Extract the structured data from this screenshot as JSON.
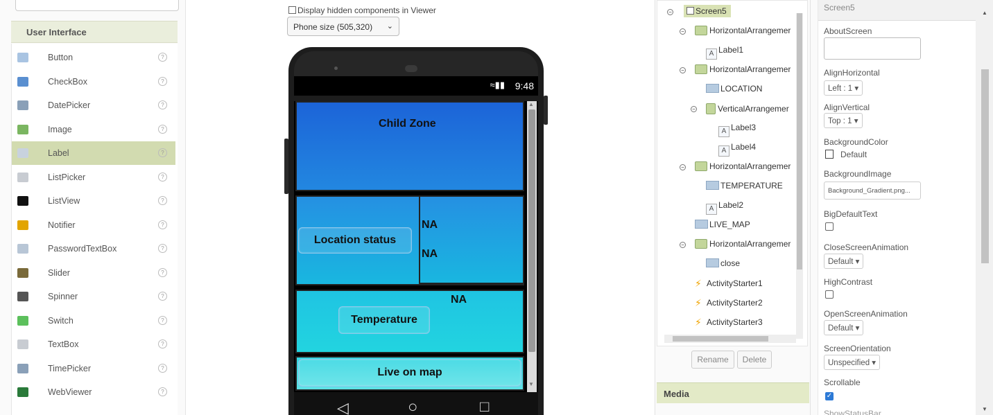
{
  "palette": {
    "section_title": "User Interface",
    "items": [
      {
        "label": "Button",
        "icon": "button-icon",
        "color": "#a9c4e2"
      },
      {
        "label": "CheckBox",
        "icon": "checkbox-icon",
        "color": "#5a8fd0"
      },
      {
        "label": "DatePicker",
        "icon": "datepicker-icon",
        "color": "#8aa0b8"
      },
      {
        "label": "Image",
        "icon": "image-icon",
        "color": "#7bb661"
      },
      {
        "label": "Label",
        "icon": "label-icon",
        "color": "#c8d2de"
      },
      {
        "label": "ListPicker",
        "icon": "listpicker-icon",
        "color": "#c8ccd2"
      },
      {
        "label": "ListView",
        "icon": "listview-icon",
        "color": "#111111"
      },
      {
        "label": "Notifier",
        "icon": "notifier-icon",
        "color": "#e2a500"
      },
      {
        "label": "PasswordTextBox",
        "icon": "password-icon",
        "color": "#b8c6d6"
      },
      {
        "label": "Slider",
        "icon": "slider-icon",
        "color": "#7a6a3a"
      },
      {
        "label": "Spinner",
        "icon": "spinner-icon",
        "color": "#555555"
      },
      {
        "label": "Switch",
        "icon": "switch-icon",
        "color": "#5cc05c"
      },
      {
        "label": "TextBox",
        "icon": "textbox-icon",
        "color": "#c8ccd2"
      },
      {
        "label": "TimePicker",
        "icon": "timepicker-icon",
        "color": "#8aa0b8"
      },
      {
        "label": "WebViewer",
        "icon": "webviewer-icon",
        "color": "#2a7a3a"
      }
    ],
    "selected": "Label",
    "help_glyph": "?"
  },
  "viewer": {
    "hidden_label": "Display hidden components in Viewer",
    "phone_size": "Phone size (505,320)",
    "status_time": "9:48",
    "title_label": "Child Zone",
    "location_button": "Location status",
    "location_value_1": "NA",
    "location_value_2": "NA",
    "temperature_value": "NA",
    "temperature_button": "Temperature",
    "map_button": "Live on map",
    "nav_back": "◁",
    "nav_home": "○",
    "nav_recent": "□"
  },
  "tree": {
    "nodes": [
      {
        "label": "Screen5",
        "type": "screen"
      },
      {
        "label": "HorizontalArrangemer",
        "type": "harr"
      },
      {
        "label": "Label1",
        "type": "label"
      },
      {
        "label": "HorizontalArrangemer",
        "type": "harr"
      },
      {
        "label": "LOCATION",
        "type": "button"
      },
      {
        "label": "VerticalArrangemer",
        "type": "varr"
      },
      {
        "label": "Label3",
        "type": "label"
      },
      {
        "label": "Label4",
        "type": "label"
      },
      {
        "label": "HorizontalArrangemer",
        "type": "harr"
      },
      {
        "label": "TEMPERATURE",
        "type": "button"
      },
      {
        "label": "Label2",
        "type": "label"
      },
      {
        "label": "LIVE_MAP",
        "type": "button"
      },
      {
        "label": "HorizontalArrangemer",
        "type": "harr"
      },
      {
        "label": "close",
        "type": "button"
      },
      {
        "label": "ActivityStarter1",
        "type": "activity"
      },
      {
        "label": "ActivityStarter2",
        "type": "activity"
      },
      {
        "label": "ActivityStarter3",
        "type": "activity"
      }
    ],
    "rename": "Rename",
    "delete": "Delete",
    "media": "Media"
  },
  "props": {
    "header": "Screen5",
    "about_screen": "AboutScreen",
    "align_horizontal": "AlignHorizontal",
    "align_horizontal_value": "Left : 1",
    "align_vertical": "AlignVertical",
    "align_vertical_value": "Top : 1",
    "background_color": "BackgroundColor",
    "background_color_value": "Default",
    "background_image": "BackgroundImage",
    "background_image_value": "Background_Gradient.png...",
    "big_default_text": "BigDefaultText",
    "close_screen_animation": "CloseScreenAnimation",
    "close_screen_animation_value": "Default",
    "high_contrast": "HighContrast",
    "open_screen_animation": "OpenScreenAnimation",
    "open_screen_animation_value": "Default",
    "screen_orientation": "ScreenOrientation",
    "screen_orientation_value": "Unspecified",
    "scrollable": "Scrollable",
    "show_status_bar": "ShowStatusBar"
  }
}
